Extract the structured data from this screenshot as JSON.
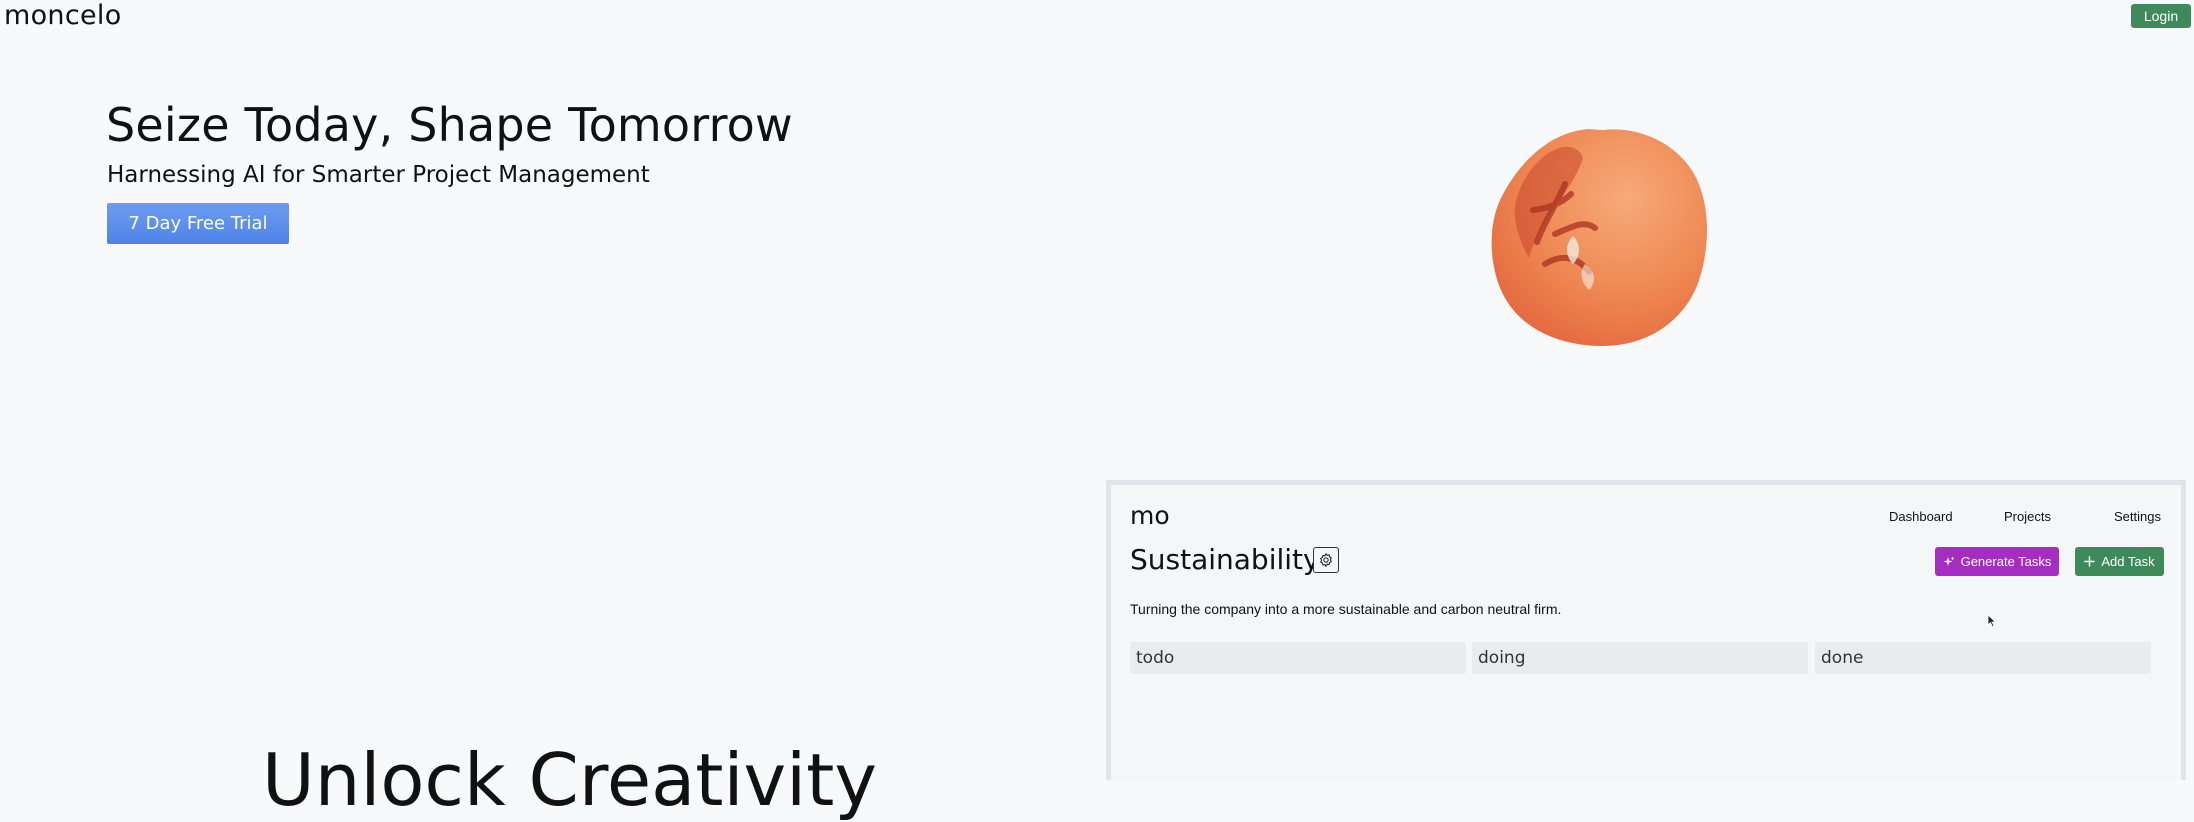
{
  "header": {
    "brand": "moncelo",
    "login_label": "Login",
    "login_color": "#3f8a5a"
  },
  "hero": {
    "title": "Seize Today, Shape Tomorrow",
    "subtitle": "Harnessing AI for Smarter Project Management",
    "cta_label": "7 Day Free Trial",
    "cta_color": "#5b8def",
    "illustration": "orange-3d-blob"
  },
  "app_preview": {
    "logo": "mo",
    "nav": [
      "Dashboard",
      "Projects",
      "Settings"
    ],
    "project_title": "Sustainability",
    "settings_icon": "gear-icon",
    "generate_label": "Generate Tasks",
    "generate_icon": "sparkle-icon",
    "generate_color": "#a62dc2",
    "add_label": "Add Task",
    "add_icon": "plus-icon",
    "add_color": "#3f8a5a",
    "description": "Turning the company into a more sustainable and carbon neutral firm.",
    "columns": [
      "todo",
      "doing",
      "done"
    ]
  },
  "section2": {
    "heading": "Unlock Creativity"
  }
}
